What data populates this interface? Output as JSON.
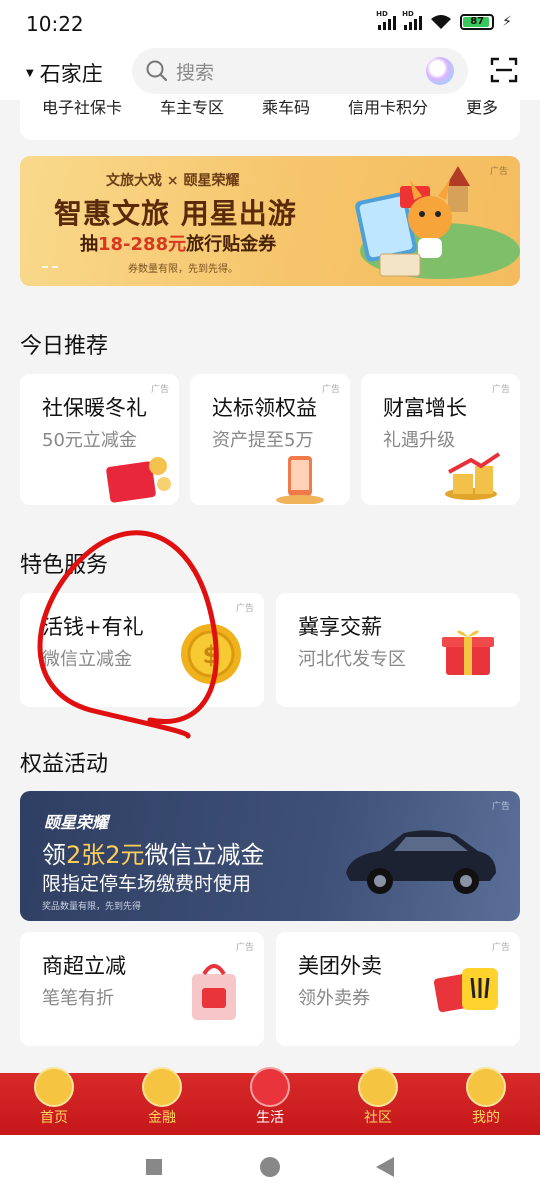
{
  "status_bar": {
    "time": "10:22",
    "battery": "87",
    "hd1": "HD",
    "hd2": "HD"
  },
  "header": {
    "city": "石家庄",
    "search_placeholder": "搜索"
  },
  "quick_links": [
    "电子社保卡",
    "车主专区",
    "乘车码",
    "信用卡积分",
    "更多"
  ],
  "promo_banner": {
    "ad_tag": "广告",
    "brand_line": "文旅大戏 × 颐星荣耀",
    "headline": "智惠文旅 用星出游",
    "sub_prefix": "抽",
    "sub_amount": "18-288元",
    "sub_suffix": "旅行贴金券",
    "note": "券数量有限，先到先得。"
  },
  "recommend": {
    "title": "今日推荐",
    "cards": [
      {
        "title": "社保暖冬礼",
        "subtitle": "50元立减金",
        "ad": "广告"
      },
      {
        "title": "达标领权益",
        "subtitle": "资产提至5万",
        "ad": "广告"
      },
      {
        "title": "财富增长",
        "subtitle": "礼遇升级",
        "ad": "广告"
      }
    ]
  },
  "services": {
    "title": "特色服务",
    "cards": [
      {
        "title": "活钱+有礼",
        "subtitle": "微信立减金",
        "ad": "广告"
      },
      {
        "title": "冀享交薪",
        "subtitle": "河北代发专区",
        "ad": ""
      }
    ]
  },
  "benefits": {
    "title": "权益活动",
    "parking_banner": {
      "ad": "广告",
      "brand": "颐星荣耀",
      "head_prefix": "领",
      "head_highlight": "2张2元",
      "head_suffix": "微信立减金",
      "subtitle": "限指定停车场缴费时使用",
      "note": "奖品数量有限，先到先得"
    },
    "cards": [
      {
        "title": "商超立减",
        "subtitle": "笔笔有折",
        "ad": "广告"
      },
      {
        "title": "美团外卖",
        "subtitle": "领外卖券",
        "ad": "广告"
      }
    ]
  },
  "tabbar": [
    {
      "label": "首页",
      "active": false
    },
    {
      "label": "金融",
      "active": false
    },
    {
      "label": "生活",
      "active": true
    },
    {
      "label": "社区",
      "active": false
    },
    {
      "label": "我的",
      "active": false
    }
  ],
  "colors": {
    "tabbar_red": "#d92a2a",
    "annotation_red": "#e01010",
    "tab_label": "#ffd760"
  }
}
